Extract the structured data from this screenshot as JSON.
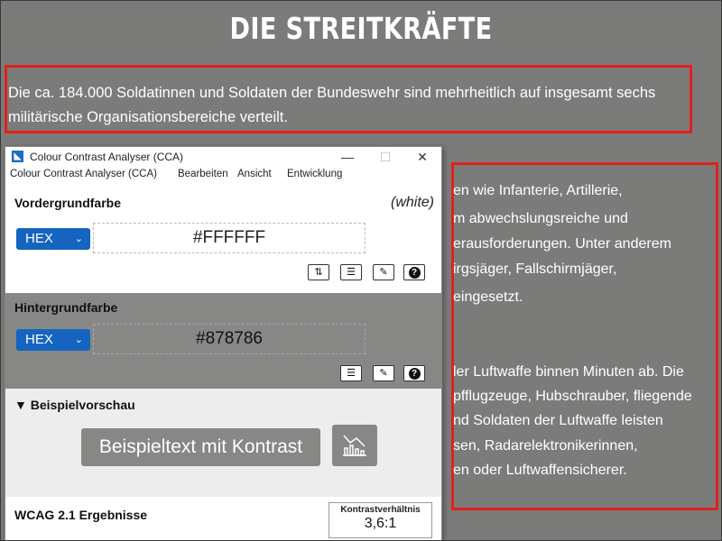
{
  "page": {
    "title": "DIE STREITKRÄFTE",
    "intro_line1": "Die ca. 184.000 Soldatinnen und Soldaten der Bundeswehr sind mehrheitlich auf insgesamt sechs",
    "intro_line2": "militärische Organisationsbereiche verteilt.",
    "right_lines": [
      "en wie Infanterie, Artillerie,",
      "m abwechslungsreiche und",
      "erausforderungen. Unter anderem",
      "irgsjäger, Fallschirmjäger,",
      "eingesetzt.",
      "ler Luftwaffe binnen Minuten ab. Die",
      "pfflugzeuge, Hubschrauber, fliegende",
      "nd Soldaten der Luftwaffe leisten",
      "sen, Radarelektronikerinnen,",
      "en oder Luftwaffensicherer."
    ]
  },
  "cca": {
    "window_title": "Colour Contrast Analyser (CCA)",
    "menu": [
      "Colour Contrast Analyser (CCA)",
      "Bearbeiten",
      "Ansicht",
      "Entwicklung"
    ],
    "foreground": {
      "label": "Vordergrundfarbe",
      "color_name": "(white)",
      "format": "HEX",
      "value": "#FFFFFF"
    },
    "background": {
      "label": "Hintergrundfarbe",
      "format": "HEX",
      "value": "#878786"
    },
    "preview": {
      "label": "▼ Beispielvorschau",
      "sample_text": "Beispieltext mit Kontrast"
    },
    "wcag": {
      "label": "WCAG 2.1 Ergebnisse",
      "ratio_label": "Kontrastverhältnis",
      "ratio_value": "3,6:1"
    }
  },
  "colors": {
    "page_bg": "#7b7b7a",
    "highlight_border": "#e2201a",
    "select_blue": "#1565c0",
    "preview_bg": "#878786",
    "foreground": "#FFFFFF"
  },
  "icons": [
    "app-icon",
    "swap-icon",
    "sliders-icon",
    "eyedropper-icon",
    "help-icon",
    "chart-icon",
    "minimize-icon",
    "maximize-icon",
    "close-icon",
    "chevron-down-icon"
  ]
}
